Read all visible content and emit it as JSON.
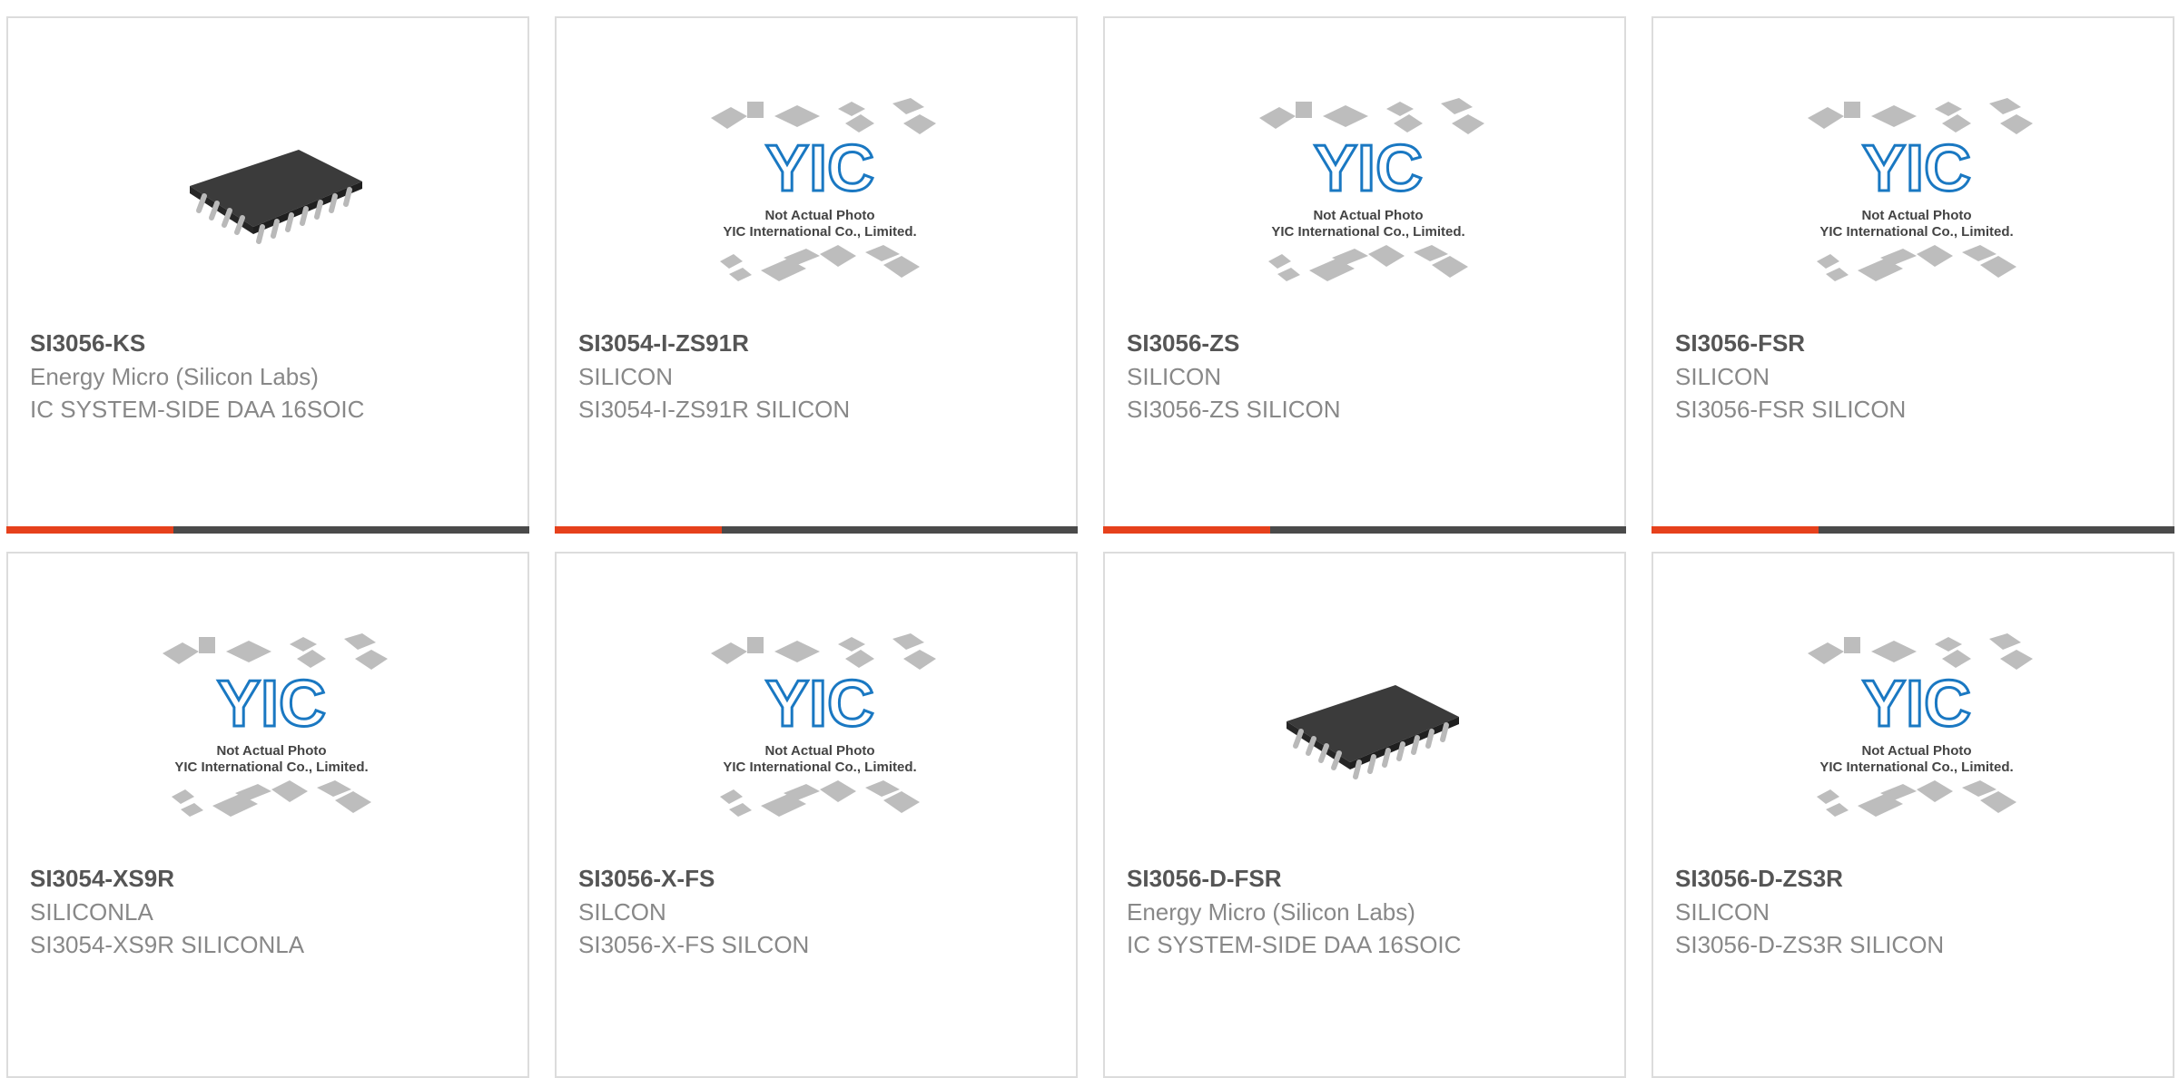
{
  "products": [
    {
      "part": "SI3056-KS",
      "manufacturer": "Energy Micro (Silicon Labs)",
      "description": "IC SYSTEM-SIDE DAA 16SOIC",
      "image": "chip-photo"
    },
    {
      "part": "SI3054-I-ZS91R",
      "manufacturer": "SILICON",
      "description": "SI3054-I-ZS91R SILICON",
      "image": "placeholder"
    },
    {
      "part": "SI3056-ZS",
      "manufacturer": "SILICON",
      "description": "SI3056-ZS SILICON",
      "image": "placeholder"
    },
    {
      "part": "SI3056-FSR",
      "manufacturer": "SILICON",
      "description": "SI3056-FSR SILICON",
      "image": "placeholder"
    },
    {
      "part": "SI3054-XS9R",
      "manufacturer": "SILICONLA",
      "description": "SI3054-XS9R SILICONLA",
      "image": "placeholder"
    },
    {
      "part": "SI3056-X-FS",
      "manufacturer": "SILCON",
      "description": "SI3056-X-FS SILCON",
      "image": "placeholder"
    },
    {
      "part": "SI3056-D-FSR",
      "manufacturer": "Energy Micro (Silicon Labs)",
      "description": "IC SYSTEM-SIDE DAA 16SOIC",
      "image": "chip-photo"
    },
    {
      "part": "SI3056-D-ZS3R",
      "manufacturer": "SILICON",
      "description": "SI3056-D-ZS3R SILICON",
      "image": "placeholder"
    }
  ],
  "placeholder": {
    "logo": "YIC",
    "line1": "Not Actual Photo",
    "line2": "YIC International Co., Limited."
  },
  "colors": {
    "accent": "#e6411c",
    "bar": "#4a4a4a",
    "logo_blue": "#1a78c2"
  }
}
